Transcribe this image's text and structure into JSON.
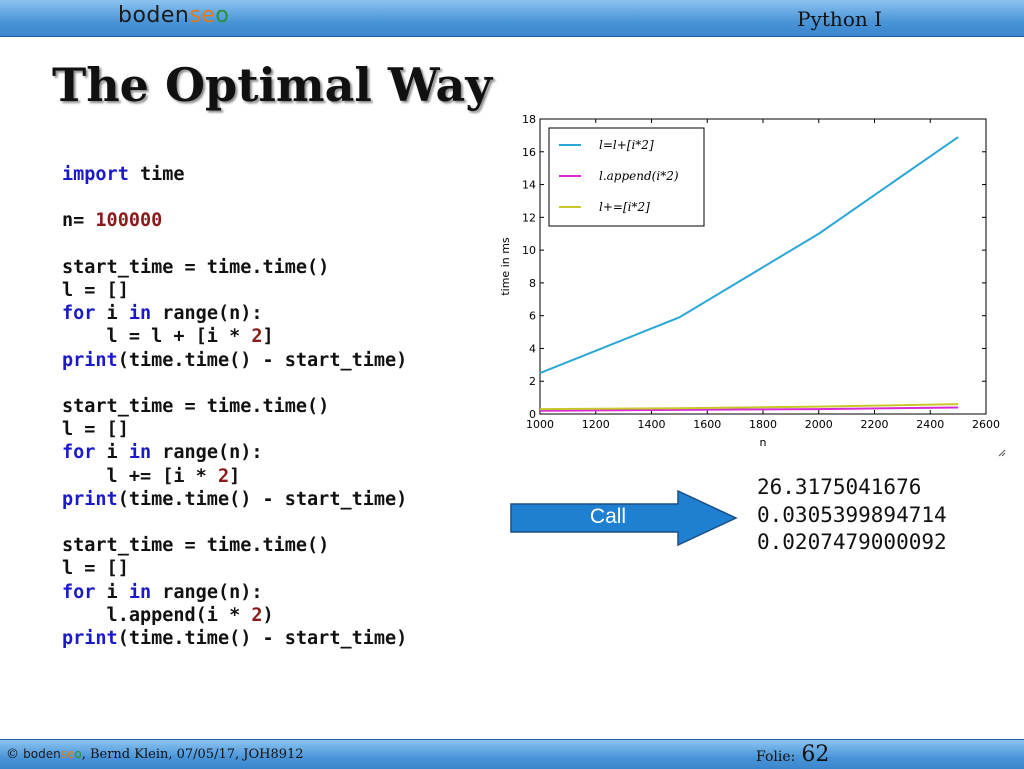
{
  "header": {
    "logo": {
      "part1": "boden",
      "part2": "se",
      "part3": "o"
    },
    "course": "Python I"
  },
  "slide": {
    "title": "The Optimal Way",
    "code_lines": [
      [
        {
          "t": "import",
          "k": "kw"
        },
        {
          "t": " time"
        }
      ],
      [],
      [
        {
          "t": "n= "
        },
        {
          "t": "100000",
          "k": "num"
        }
      ],
      [],
      [
        {
          "t": "start_time = time.time()"
        }
      ],
      [
        {
          "t": "l = []"
        }
      ],
      [
        {
          "t": "for",
          "k": "kw"
        },
        {
          "t": " i "
        },
        {
          "t": "in",
          "k": "kw"
        },
        {
          "t": " range(n):"
        }
      ],
      [
        {
          "t": "    l = l + [i * "
        },
        {
          "t": "2",
          "k": "num"
        },
        {
          "t": "]"
        }
      ],
      [
        {
          "t": "print",
          "k": "kw"
        },
        {
          "t": "(time.time() - start_time)"
        }
      ],
      [],
      [
        {
          "t": "start_time = time.time()"
        }
      ],
      [
        {
          "t": "l = []"
        }
      ],
      [
        {
          "t": "for",
          "k": "kw"
        },
        {
          "t": " i "
        },
        {
          "t": "in",
          "k": "kw"
        },
        {
          "t": " range(n):"
        }
      ],
      [
        {
          "t": "    l += [i * "
        },
        {
          "t": "2",
          "k": "num"
        },
        {
          "t": "]"
        }
      ],
      [
        {
          "t": "print",
          "k": "kw"
        },
        {
          "t": "(time.time() - start_time)"
        }
      ],
      [],
      [
        {
          "t": "start_time = time.time()"
        }
      ],
      [
        {
          "t": "l = []"
        }
      ],
      [
        {
          "t": "for",
          "k": "kw"
        },
        {
          "t": " i "
        },
        {
          "t": "in",
          "k": "kw"
        },
        {
          "t": " range(n):"
        }
      ],
      [
        {
          "t": "    l.append(i * "
        },
        {
          "t": "2",
          "k": "num"
        },
        {
          "t": ")"
        }
      ],
      [
        {
          "t": "print",
          "k": "kw"
        },
        {
          "t": "(time.time() - start_time)"
        }
      ]
    ],
    "call_label": "Call",
    "results": [
      "26.3175041676",
      "0.0305399894714",
      "0.0207479000092"
    ]
  },
  "chart_data": {
    "type": "line",
    "xlabel": "n",
    "ylabel": "time in ms",
    "xlim": [
      1000,
      2600
    ],
    "ylim": [
      0,
      18
    ],
    "xticks": [
      1000,
      1200,
      1400,
      1600,
      1800,
      2000,
      2200,
      2400,
      2600
    ],
    "yticks": [
      0,
      2,
      4,
      6,
      8,
      10,
      12,
      14,
      16,
      18
    ],
    "legend_position": "top-left",
    "series": [
      {
        "name": "l=l+[i*2]",
        "color": "#2aa7d6",
        "x": [
          1000,
          1500,
          2000,
          2500
        ],
        "y": [
          2.5,
          5.9,
          11.0,
          16.9
        ]
      },
      {
        "name": "l.append(i*2)",
        "color": "#d62ad6",
        "x": [
          1000,
          1500,
          2000,
          2500
        ],
        "y": [
          0.2,
          0.25,
          0.3,
          0.4
        ]
      },
      {
        "name": "l+=[i*2]",
        "color": "#c8c82a",
        "x": [
          1000,
          1500,
          2000,
          2500
        ],
        "y": [
          0.3,
          0.35,
          0.45,
          0.6
        ]
      }
    ]
  },
  "footer": {
    "copyright": "© ",
    "logo": {
      "part1": "boden",
      "part2": "se",
      "part3": "o"
    },
    "text": ", Bernd Klein, 07/05/17, JOH8912",
    "folie_label": "Folie:",
    "folie_number": "62"
  },
  "colors": {
    "keyword": "#1a1ac8",
    "number": "#8b1a1a",
    "bar": "#4a95d8",
    "arrow": "#1f7fd0"
  }
}
